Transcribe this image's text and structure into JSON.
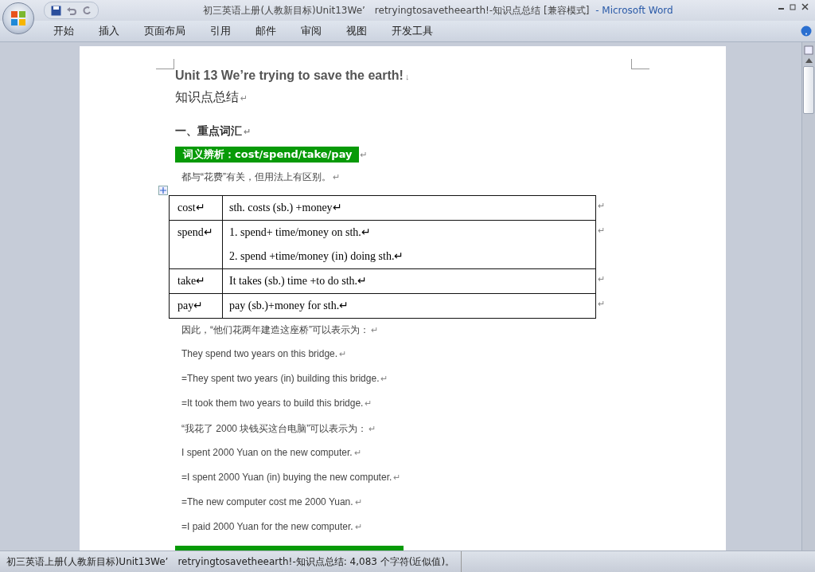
{
  "window": {
    "title": "初三英语上册(人教新目标)Unit13We’　retryingtosavetheearth!-知识点总结 [兼容模式]",
    "app": "- Microsoft Word"
  },
  "ribbon_tabs": [
    {
      "label": "开始",
      "selected": false
    },
    {
      "label": "插入",
      "selected": false
    },
    {
      "label": "页面布局",
      "selected": false
    },
    {
      "label": "引用",
      "selected": false
    },
    {
      "label": "邮件",
      "selected": false
    },
    {
      "label": "审阅",
      "selected": false
    },
    {
      "label": "视图",
      "selected": false
    },
    {
      "label": "开发工具",
      "selected": false
    }
  ],
  "document": {
    "title": {
      "text": "Unit 13 We’re trying to save the earth!",
      "mark": "↓"
    },
    "subtitle": {
      "text": "知识点总结",
      "mark": "↵"
    },
    "section": {
      "text": "一、重点词汇",
      "mark": "↵"
    },
    "highlight": {
      "text": "词义辨析：cost/spend/take/pay",
      "mark": "↵"
    },
    "intro": {
      "text": "都与“花费”有关，但用法上有区别。",
      "mark": "↵"
    },
    "table": {
      "rows": [
        {
          "word": "cost↵",
          "lines": [
            "sth. costs (sb.) +money↵"
          ],
          "mark": "↵"
        },
        {
          "word": "spend↵",
          "lines": [
            "1. spend+ time/money  on sth.↵",
            "2. spend +time/money  (in)  doing sth.↵"
          ],
          "mark": "↵"
        },
        {
          "word": "take↵",
          "lines": [
            "It takes (sb.) time +to do sth.↵"
          ],
          "mark": "↵"
        },
        {
          "word": "pay↵",
          "lines": [
            "pay (sb.)+money  for sth.↵"
          ],
          "mark": "↵"
        }
      ]
    },
    "paragraphs": [
      {
        "text": "因此，“他们花两年建造这座桥”可以表示为：",
        "mark": "↵"
      },
      {
        "text": "They spend two years on this bridge.",
        "mark": "↵"
      },
      {
        "text": "=They spent two years (in) building this bridge.",
        "mark": "↵"
      },
      {
        "text": "=It took them two years to build this bridge.",
        "mark": "↵"
      },
      {
        "text": "“我花了 2000 块钱买这台电脑”可以表示为：",
        "mark": "↵"
      },
      {
        "text": "I  spent 2000 Yuan on the new computer.",
        "mark": "↵"
      },
      {
        "text": "=I  spent 2000 Yuan (in) buying the new computer.",
        "mark": "↵"
      },
      {
        "text": "=The new computer cost me 2000 Yuan.",
        "mark": "↵"
      },
      {
        "text": "=I  paid 2000 Yuan for the new computer.",
        "mark": "↵"
      }
    ]
  },
  "status_bar": {
    "text": "初三英语上册(人教新目标)Unit13We’　retryingtosavetheearth!-知识点总结: 4,083 个字符(近似值)。"
  }
}
